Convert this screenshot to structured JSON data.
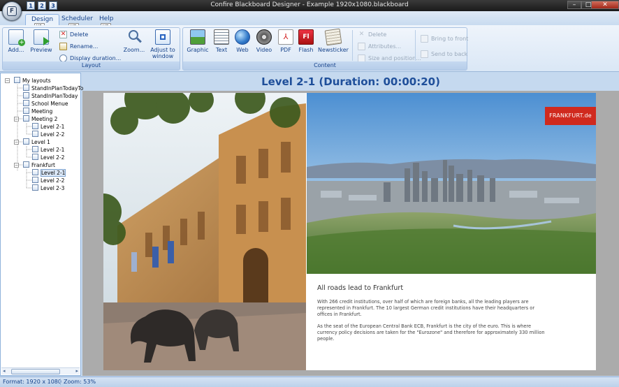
{
  "window": {
    "title": "Confire Blackboard Designer - Example 1920x1080.blackboard",
    "controls": [
      "–",
      "□",
      "✕"
    ]
  },
  "qat": {
    "items": [
      "1",
      "2",
      "3"
    ]
  },
  "tabs": [
    {
      "label": "Design",
      "keytip": "Y1"
    },
    {
      "label": "Scheduler",
      "keytip": "Y2"
    },
    {
      "label": "Help",
      "keytip": "Y3"
    }
  ],
  "ribbon": {
    "layout": {
      "label": "Layout",
      "add": "Add...",
      "preview": "Preview",
      "delete": "Delete",
      "rename": "Rename...",
      "display_duration": "Display duration...",
      "zoom": "Zoom...",
      "adjust": "Adjust to window"
    },
    "content": {
      "label": "Content",
      "graphic": "Graphic",
      "text": "Text",
      "web": "Web",
      "video": "Video",
      "pdf": "PDF",
      "flash": "Flash",
      "newsticker": "Newsticker",
      "delete": "Delete",
      "attributes": "Attributes...",
      "size_pos": "Size and position..."
    },
    "order": {
      "front": "Bring to front",
      "back": "Send to back"
    }
  },
  "tree": {
    "root": "My layouts",
    "items": [
      "StandInPlanTodayTo",
      "StandInPlanToday",
      "School Menue",
      "Meeting",
      "Meeting 2",
      "Level 2-1",
      "Level 2-2",
      "Level 1",
      "Level 2-1",
      "Level 2-2",
      "Frankfurt",
      "Level 2-1",
      "Level 2-2",
      "Level 2-3"
    ]
  },
  "editor": {
    "title": "Level 2-1 (Duration: 00:00:20)"
  },
  "slide": {
    "brand": "FRANKFURT.de",
    "headline": "All roads lead to Frankfurt",
    "paragraphs": [
      "With 266 credit institutions, over half of which are foreign banks, all the leading players are represented in Frankfurt. The 10 largest German credit institutions have their headquarters or offices in Frankfurt.",
      "As the seat of the European Central Bank ECB, Frankfurt is the city of the euro. This is where currency policy decisions are taken for the \"Eurozone\" and therefore for approximately 330 million people."
    ]
  },
  "status": {
    "format": "Format: 1920 x 1080",
    "zoom": "Zoom: 53%"
  }
}
